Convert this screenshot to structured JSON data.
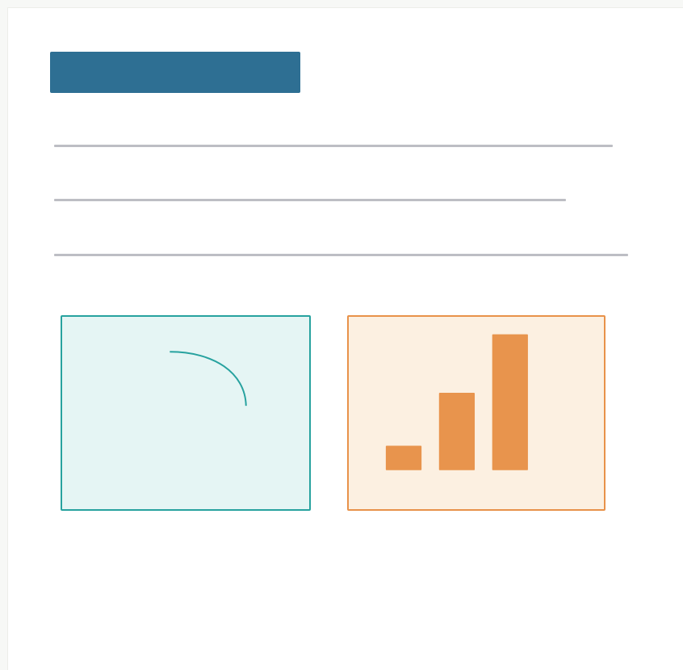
{
  "colors": {
    "title_bar": "#2e6f93",
    "text_line": "#bdbec4",
    "left_card_border": "#27a29f",
    "left_card_fill": "#e5f5f4",
    "right_card_border": "#e8924a",
    "right_card_fill": "#fcf0e1",
    "bar_fill": "#e8944d"
  },
  "left_card": {
    "icon": "arc-icon"
  },
  "right_card": {
    "icon": "bar-chart-icon",
    "bar_levels": [
      0.18,
      0.57,
      1.0
    ]
  }
}
